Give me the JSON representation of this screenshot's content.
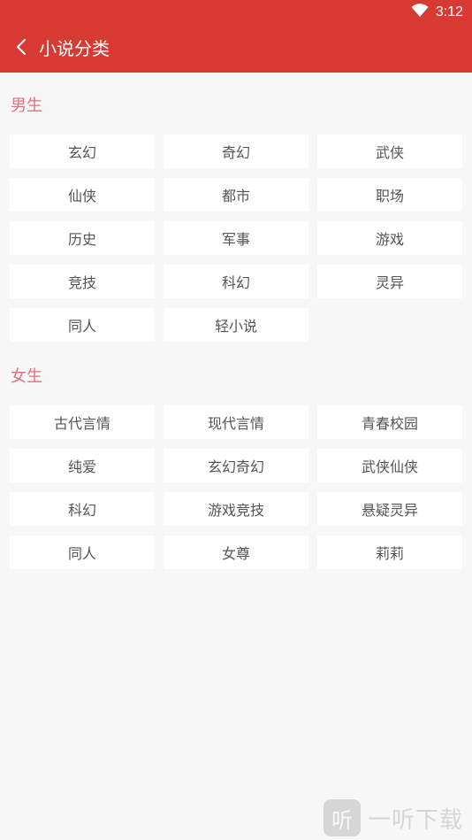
{
  "status_bar": {
    "time": "3:12",
    "wifi_icon": "wifi-icon"
  },
  "header": {
    "back_icon": "chevron-left-icon",
    "title": "小说分类"
  },
  "sections": {
    "male": {
      "title": "男生",
      "items": [
        "玄幻",
        "奇幻",
        "武侠",
        "仙侠",
        "都市",
        "职场",
        "历史",
        "军事",
        "游戏",
        "竞技",
        "科幻",
        "灵异",
        "同人",
        "轻小说"
      ]
    },
    "female": {
      "title": "女生",
      "items": [
        "古代言情",
        "现代言情",
        "青春校园",
        "纯爱",
        "玄幻奇幻",
        "武侠仙侠",
        "科幻",
        "游戏竞技",
        "悬疑灵异",
        "同人",
        "女尊",
        "莉莉"
      ]
    }
  },
  "watermark": {
    "icon_char": "听",
    "text": "一听下载"
  },
  "colors": {
    "header_bg": "#d63a32",
    "section_title": "#e46f7e",
    "page_bg": "#f7f7f7",
    "tile_bg": "#ffffff",
    "tile_text": "#555555"
  }
}
